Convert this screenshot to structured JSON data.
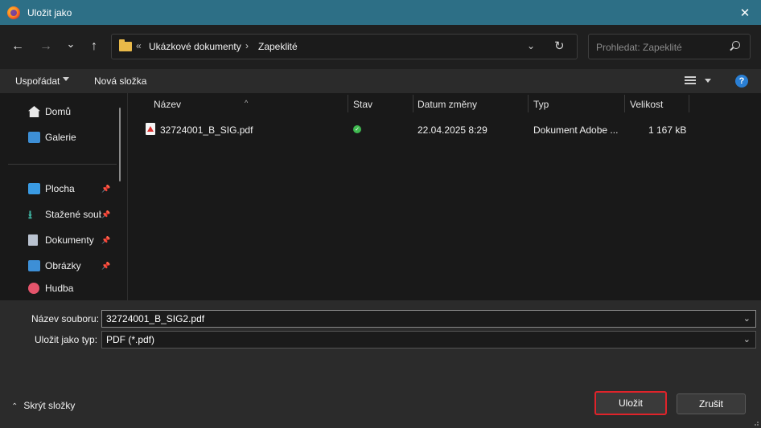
{
  "window": {
    "title": "Uložit jako",
    "close_glyph": "✕"
  },
  "nav": {
    "back_glyph": "←",
    "forward_glyph": "→",
    "recent_glyph": "⌄",
    "up_glyph": "↑",
    "breadcrumb_overflow": "«",
    "breadcrumb_sep": "›",
    "breadcrumb": [
      "Ukázkové dokumenty",
      "Zapeklité"
    ],
    "address_dropdown_glyph": "⌄",
    "refresh_glyph": "↻",
    "search_placeholder": "Prohledat: Zapeklité"
  },
  "toolbar": {
    "organize_label": "Uspořádat",
    "new_folder_label": "Nová složka",
    "help_glyph": "?"
  },
  "sidebar": {
    "items": [
      {
        "label": "Domů",
        "icon": "home-icon"
      },
      {
        "label": "Galerie",
        "icon": "gallery-icon"
      },
      {
        "label": "Plocha",
        "icon": "desktop-icon",
        "pinned": true
      },
      {
        "label": "Stažené soubory",
        "icon": "downloads-icon",
        "pinned": true
      },
      {
        "label": "Dokumenty",
        "icon": "documents-icon",
        "pinned": true
      },
      {
        "label": "Obrázky",
        "icon": "pictures-icon",
        "pinned": true
      },
      {
        "label": "Hudba",
        "icon": "music-icon"
      }
    ]
  },
  "filelist": {
    "columns": [
      "Název",
      "Stav",
      "Datum změny",
      "Typ",
      "Velikost"
    ],
    "sort_glyph": "^",
    "rows": [
      {
        "name": "32724001_B_SIG.pdf",
        "status": "synced",
        "date": "22.04.2025 8:29",
        "type": "Dokument Adobe ...",
        "size": "1 167 kB"
      }
    ]
  },
  "form": {
    "filename_label": "Název souboru:",
    "filename_value": "32724001_B_SIG2.pdf",
    "filetype_label": "Uložit jako typ:",
    "filetype_value": "PDF (*.pdf)",
    "hide_folders_label": "Skrýt složky",
    "save_label": "Uložit",
    "cancel_label": "Zrušit"
  },
  "colors": {
    "titlebar": "#2d6f86",
    "accent_focus": "#e0232a",
    "status_ok": "#3fb950"
  }
}
